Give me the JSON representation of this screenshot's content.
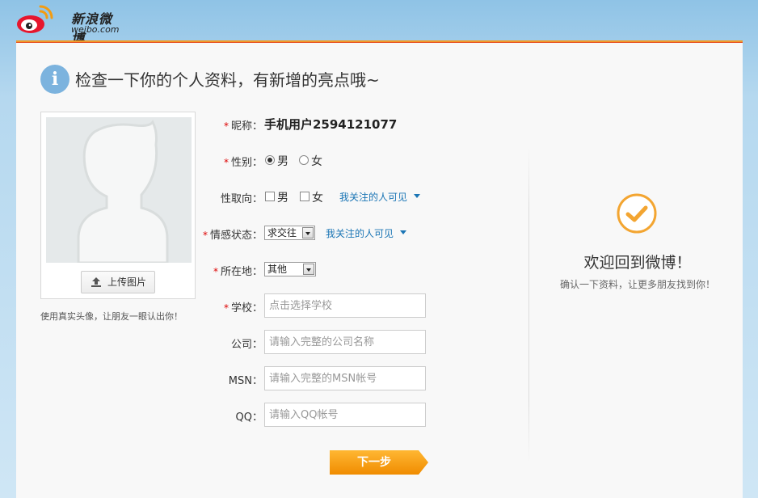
{
  "brand": {
    "name": "新浪微博",
    "domain": "weibo.com",
    "accent": "#e6162d"
  },
  "page": {
    "title": "检查一下你的个人资料，有新增的亮点哦~"
  },
  "avatar": {
    "upload_label": "上传图片",
    "hint": "使用真实头像，让朋友一眼认出你！"
  },
  "form": {
    "required_mark": "*",
    "nickname": {
      "label": "昵称：",
      "value": "手机用户2594121077"
    },
    "gender": {
      "label": "性别：",
      "options": [
        "男",
        "女"
      ],
      "selected": "男"
    },
    "orientation": {
      "label": "性取向：",
      "options": [
        "男",
        "女"
      ],
      "privacy": "我关注的人可见"
    },
    "relationship": {
      "label": "情感状态：",
      "selected": "求交往",
      "privacy": "我关注的人可见"
    },
    "location": {
      "label": "所在地：",
      "selected": "其他"
    },
    "school": {
      "label": "学校：",
      "placeholder": "点击选择学校"
    },
    "company": {
      "label": "公司：",
      "placeholder": "请输入完整的公司名称"
    },
    "msn": {
      "label": "MSN：",
      "placeholder": "请输入完整的MSN帐号"
    },
    "qq": {
      "label": "QQ：",
      "placeholder": "请输入QQ帐号"
    },
    "next_label": "下一步"
  },
  "welcome": {
    "title": "欢迎回到微博！",
    "subtitle": "确认一下资料，让更多朋友找到你！"
  },
  "colors": {
    "accent_orange": "#f39c12",
    "link_blue": "#1a75b5",
    "required_red": "#dd0000",
    "header_blue": "#8fc3e6"
  }
}
